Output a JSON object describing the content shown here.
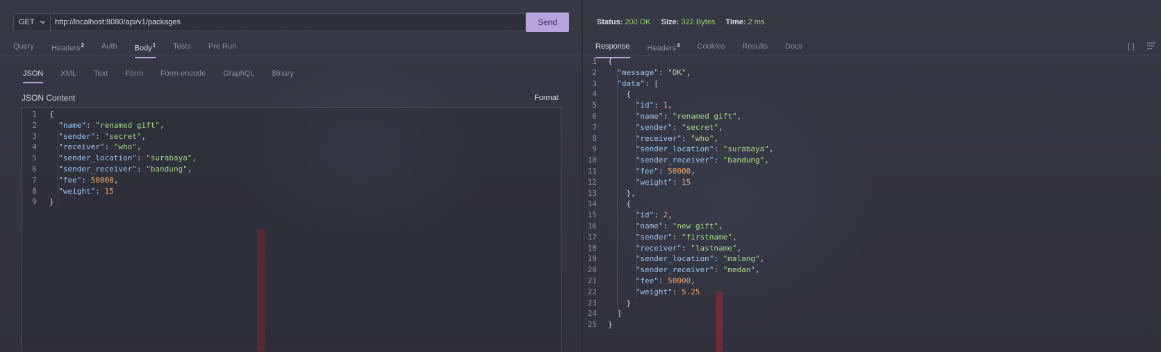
{
  "request": {
    "method": "GET",
    "url": "http://localhost:8080/api/v1/packages",
    "send_label": "Send"
  },
  "left_tabs": [
    {
      "label": "Query",
      "badge": ""
    },
    {
      "label": "Headers",
      "badge": "2"
    },
    {
      "label": "Auth",
      "badge": ""
    },
    {
      "label": "Body",
      "badge": "1",
      "active": true
    },
    {
      "label": "Tests",
      "badge": ""
    },
    {
      "label": "Pre Run",
      "badge": ""
    }
  ],
  "body_tabs": [
    {
      "label": "JSON",
      "active": true
    },
    {
      "label": "XML"
    },
    {
      "label": "Text"
    },
    {
      "label": "Form"
    },
    {
      "label": "Form-encode"
    },
    {
      "label": "GraphQL"
    },
    {
      "label": "Binary"
    }
  ],
  "editor": {
    "label": "JSON Content",
    "format_label": "Format",
    "lines": [
      "{",
      "  \"name\": \"renamed gift\",",
      "  \"sender\": \"secret\",",
      "  \"receiver\": \"who\",",
      "  \"sender_location\": \"surabaya\",",
      "  \"sender_receiver\": \"bandung\",",
      "  \"fee\": 50000,",
      "  \"weight\": 15",
      "}"
    ]
  },
  "status": {
    "status_label": "Status:",
    "status_value": "200 OK",
    "size_label": "Size:",
    "size_value": "322 Bytes",
    "time_label": "Time:",
    "time_value": "2 ms"
  },
  "right_tabs": [
    {
      "label": "Response",
      "badge": "",
      "active": true
    },
    {
      "label": "Headers",
      "badge": "4"
    },
    {
      "label": "Cookies",
      "badge": ""
    },
    {
      "label": "Results",
      "badge": ""
    },
    {
      "label": "Docs",
      "badge": ""
    }
  ],
  "right_icons": [
    "braces-icon",
    "wrap-lines-icon"
  ],
  "response": {
    "lines": [
      "{",
      "  \"message\": \"OK\",",
      "  \"data\": [",
      "    {",
      "      \"id\": 1,",
      "      \"name\": \"renamed gift\",",
      "      \"sender\": \"secret\",",
      "      \"receiver\": \"who\",",
      "      \"sender_location\": \"surabaya\",",
      "      \"sender_receiver\": \"bandung\",",
      "      \"fee\": 50000,",
      "      \"weight\": 15",
      "    },",
      "    {",
      "      \"id\": 2,",
      "      \"name\": \"new gift\",",
      "      \"sender\": \"firstname\",",
      "      \"receiver\": \"lastname\",",
      "      \"sender_location\": \"malang\",",
      "      \"sender_receiver\": \"medan\",",
      "      \"fee\": 50000,",
      "      \"weight\": 5.25",
      "    }",
      "  ]",
      "}"
    ]
  },
  "colors": {
    "accent": "#b7a4dd",
    "ok": "#8fd16e",
    "key": "#9cc7f5",
    "string": "#a8d98a",
    "number": "#f0a46c"
  }
}
